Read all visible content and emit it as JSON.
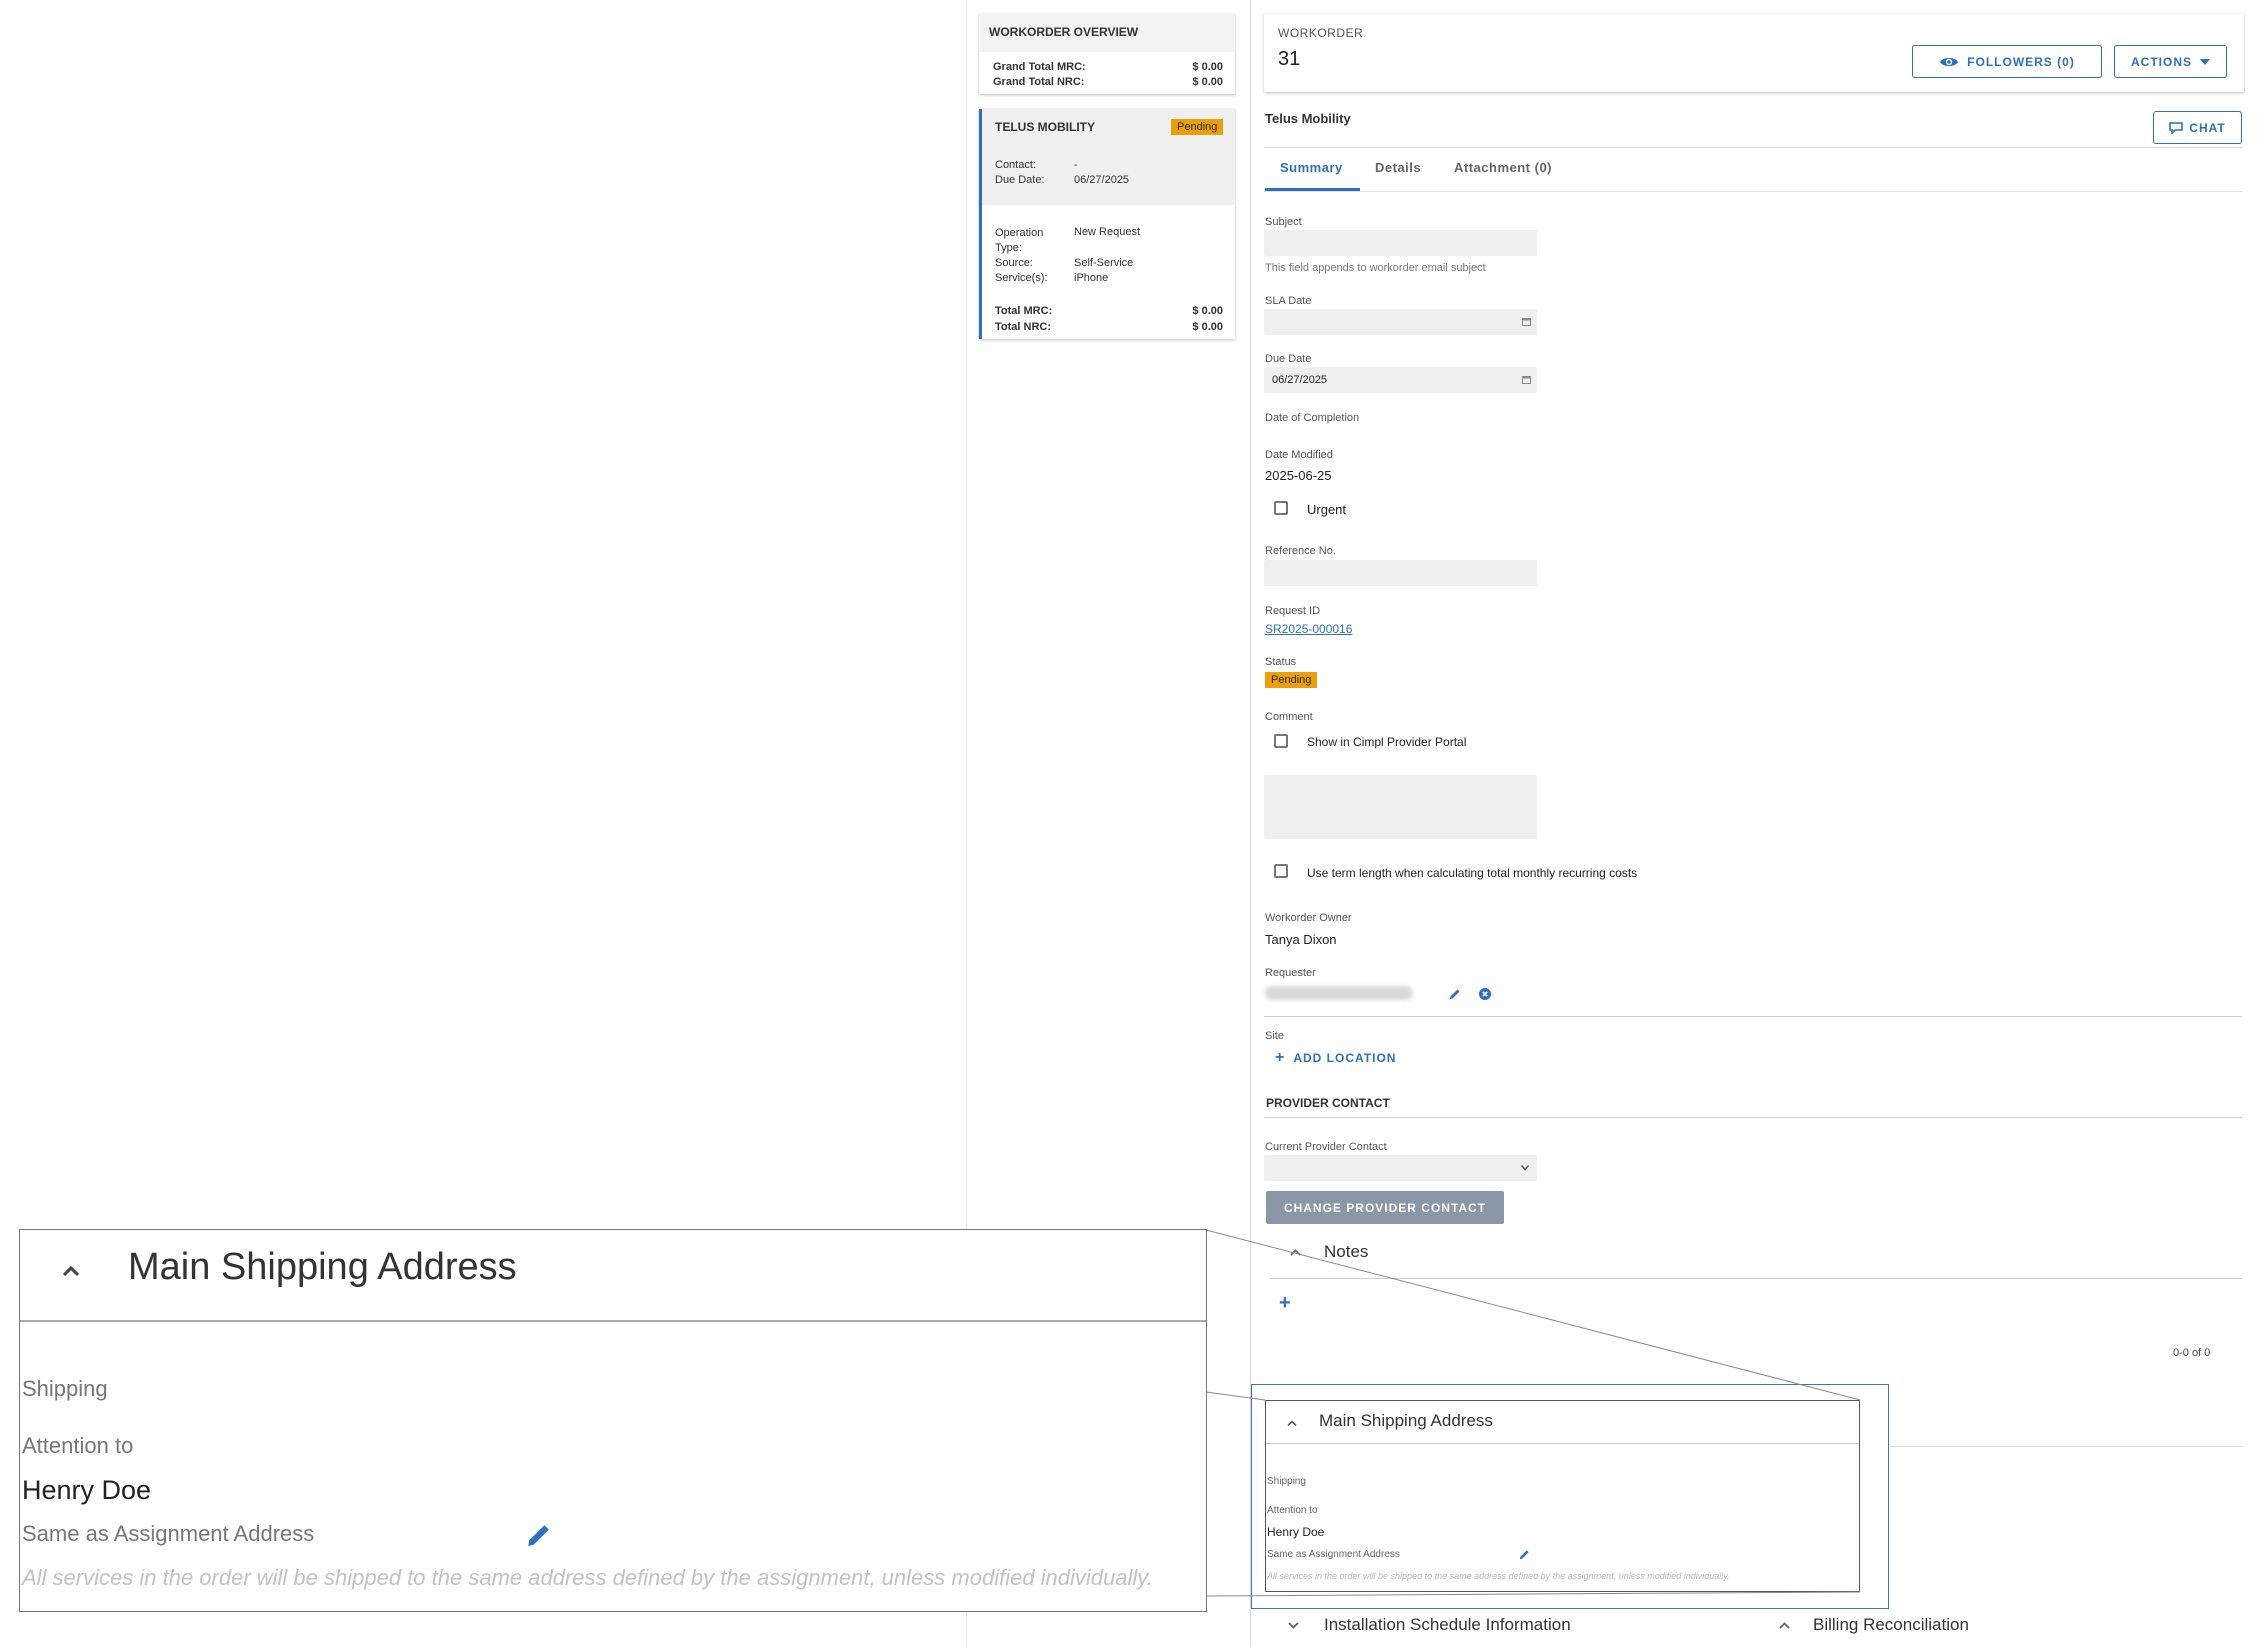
{
  "overview": {
    "title": "WORKORDER OVERVIEW",
    "grand_mrc_label": "Grand Total MRC:",
    "grand_mrc_value": "$ 0.00",
    "grand_nrc_label": "Grand Total NRC:",
    "grand_nrc_value": "$ 0.00"
  },
  "provider_card": {
    "name": "TELUS MOBILITY",
    "status": "Pending",
    "contact_label": "Contact:",
    "contact_value": "-",
    "due_label": "Due Date:",
    "due_value": "06/27/2025",
    "operation_label_1": "Operation",
    "operation_label_2": "Type:",
    "operation_value": "New Request",
    "source_label": "Source:",
    "source_value": "Self-Service",
    "services_label": "Service(s):",
    "services_value": "iPhone",
    "mrc_label": "Total MRC:",
    "mrc_value": "$ 0.00",
    "nrc_label": "Total NRC:",
    "nrc_value": "$ 0.00"
  },
  "header": {
    "label": "WORKORDER",
    "number": "31",
    "followers_label": "FOLLOWERS (0)",
    "actions_label": "ACTIONS",
    "provider": "Telus Mobility",
    "chat_label": "CHAT"
  },
  "tabs": [
    "Summary",
    "Details",
    "Attachment (0)"
  ],
  "form": {
    "subject_label": "Subject",
    "subject_value": "",
    "subject_hint": "This field appends to workorder email subject",
    "sla_label": "SLA Date",
    "sla_value": "",
    "due_label": "Due Date",
    "due_value": "06/27/2025",
    "completion_label": "Date of Completion",
    "modified_label": "Date Modified",
    "modified_value": "2025-06-25",
    "urgent_label": "Urgent",
    "reference_label": "Reference No.",
    "reference_value": "",
    "request_id_label": "Request ID",
    "request_id_value": "SR2025-000016",
    "status_label": "Status",
    "status_value": "Pending",
    "comment_label": "Comment",
    "show_portal_label": "Show in Cimpl Provider Portal",
    "comment_value": "",
    "term_label": "Use term length when calculating total monthly recurring costs",
    "owner_label": "Workorder Owner",
    "owner_value": "Tanya Dixon",
    "requester_label": "Requester",
    "site_label": "Site",
    "add_location_label": "ADD LOCATION",
    "provider_contact_title": "PROVIDER CONTACT",
    "current_contact_label": "Current Provider Contact",
    "current_contact_value": "",
    "change_contact_label": "CHANGE PROVIDER CONTACT"
  },
  "notes": {
    "title": "Notes",
    "pagination": "0-0 of 0"
  },
  "shipping": {
    "title": "Main Shipping Address",
    "shipping_label": "Shipping",
    "attention_label": "Attention to",
    "attention_value": "Henry Doe",
    "same_as_label": "Same as Assignment Address",
    "note": "All services in the order will be shipped to the same address defined by the assignment, unless modified individually."
  },
  "bottom": {
    "installation_label": "Installation Schedule Information",
    "billing_label": "Billing Reconciliation"
  },
  "colors": {
    "accent": "#2d6fc1",
    "pending": "#e8a10a",
    "highlight_frame": "#3f6fd1"
  }
}
